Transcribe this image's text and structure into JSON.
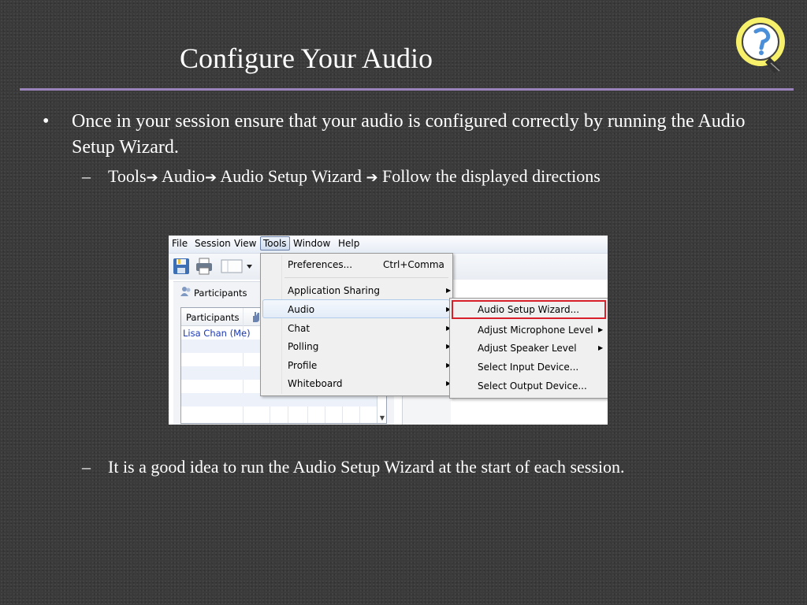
{
  "slide": {
    "title": "Configure Your Audio",
    "bullet_marker": "•",
    "bullet_text": "Once in your session ensure that your audio is configured correctly by running the Audio Setup Wizard.",
    "sub_dash": "–",
    "path_steps": [
      "Tools",
      "Audio",
      "Audio Setup Wizard",
      "Follow the displayed directions"
    ],
    "arrow_glyph": "➔",
    "tip_text": "It is a good idea to run the Audio Setup Wizard at the start of each session."
  },
  "colors": {
    "title_rule": "#9b84bb",
    "background": "#3b3b3b",
    "highlight_box": "#d8202a"
  },
  "logo": {
    "icon": "lightbulb-logo"
  },
  "app": {
    "menu_labels": [
      "File",
      "Session",
      "View",
      "Tools",
      "Window",
      "Help"
    ],
    "panel_title": "Participants",
    "list_header": "Participants",
    "list_first_row": "Lisa Chan (Me)",
    "tools_menu": {
      "preferences": "Preferences...",
      "preferences_shortcut": "Ctrl+Comma",
      "items": [
        "Application Sharing",
        "Audio",
        "Chat",
        "Polling",
        "Profile",
        "Whiteboard"
      ]
    },
    "audio_menu": {
      "items": [
        "Audio Setup Wizard...",
        "Adjust Microphone Level",
        "Adjust Speaker Level",
        "Select Input Device...",
        "Select Output Device..."
      ]
    }
  }
}
